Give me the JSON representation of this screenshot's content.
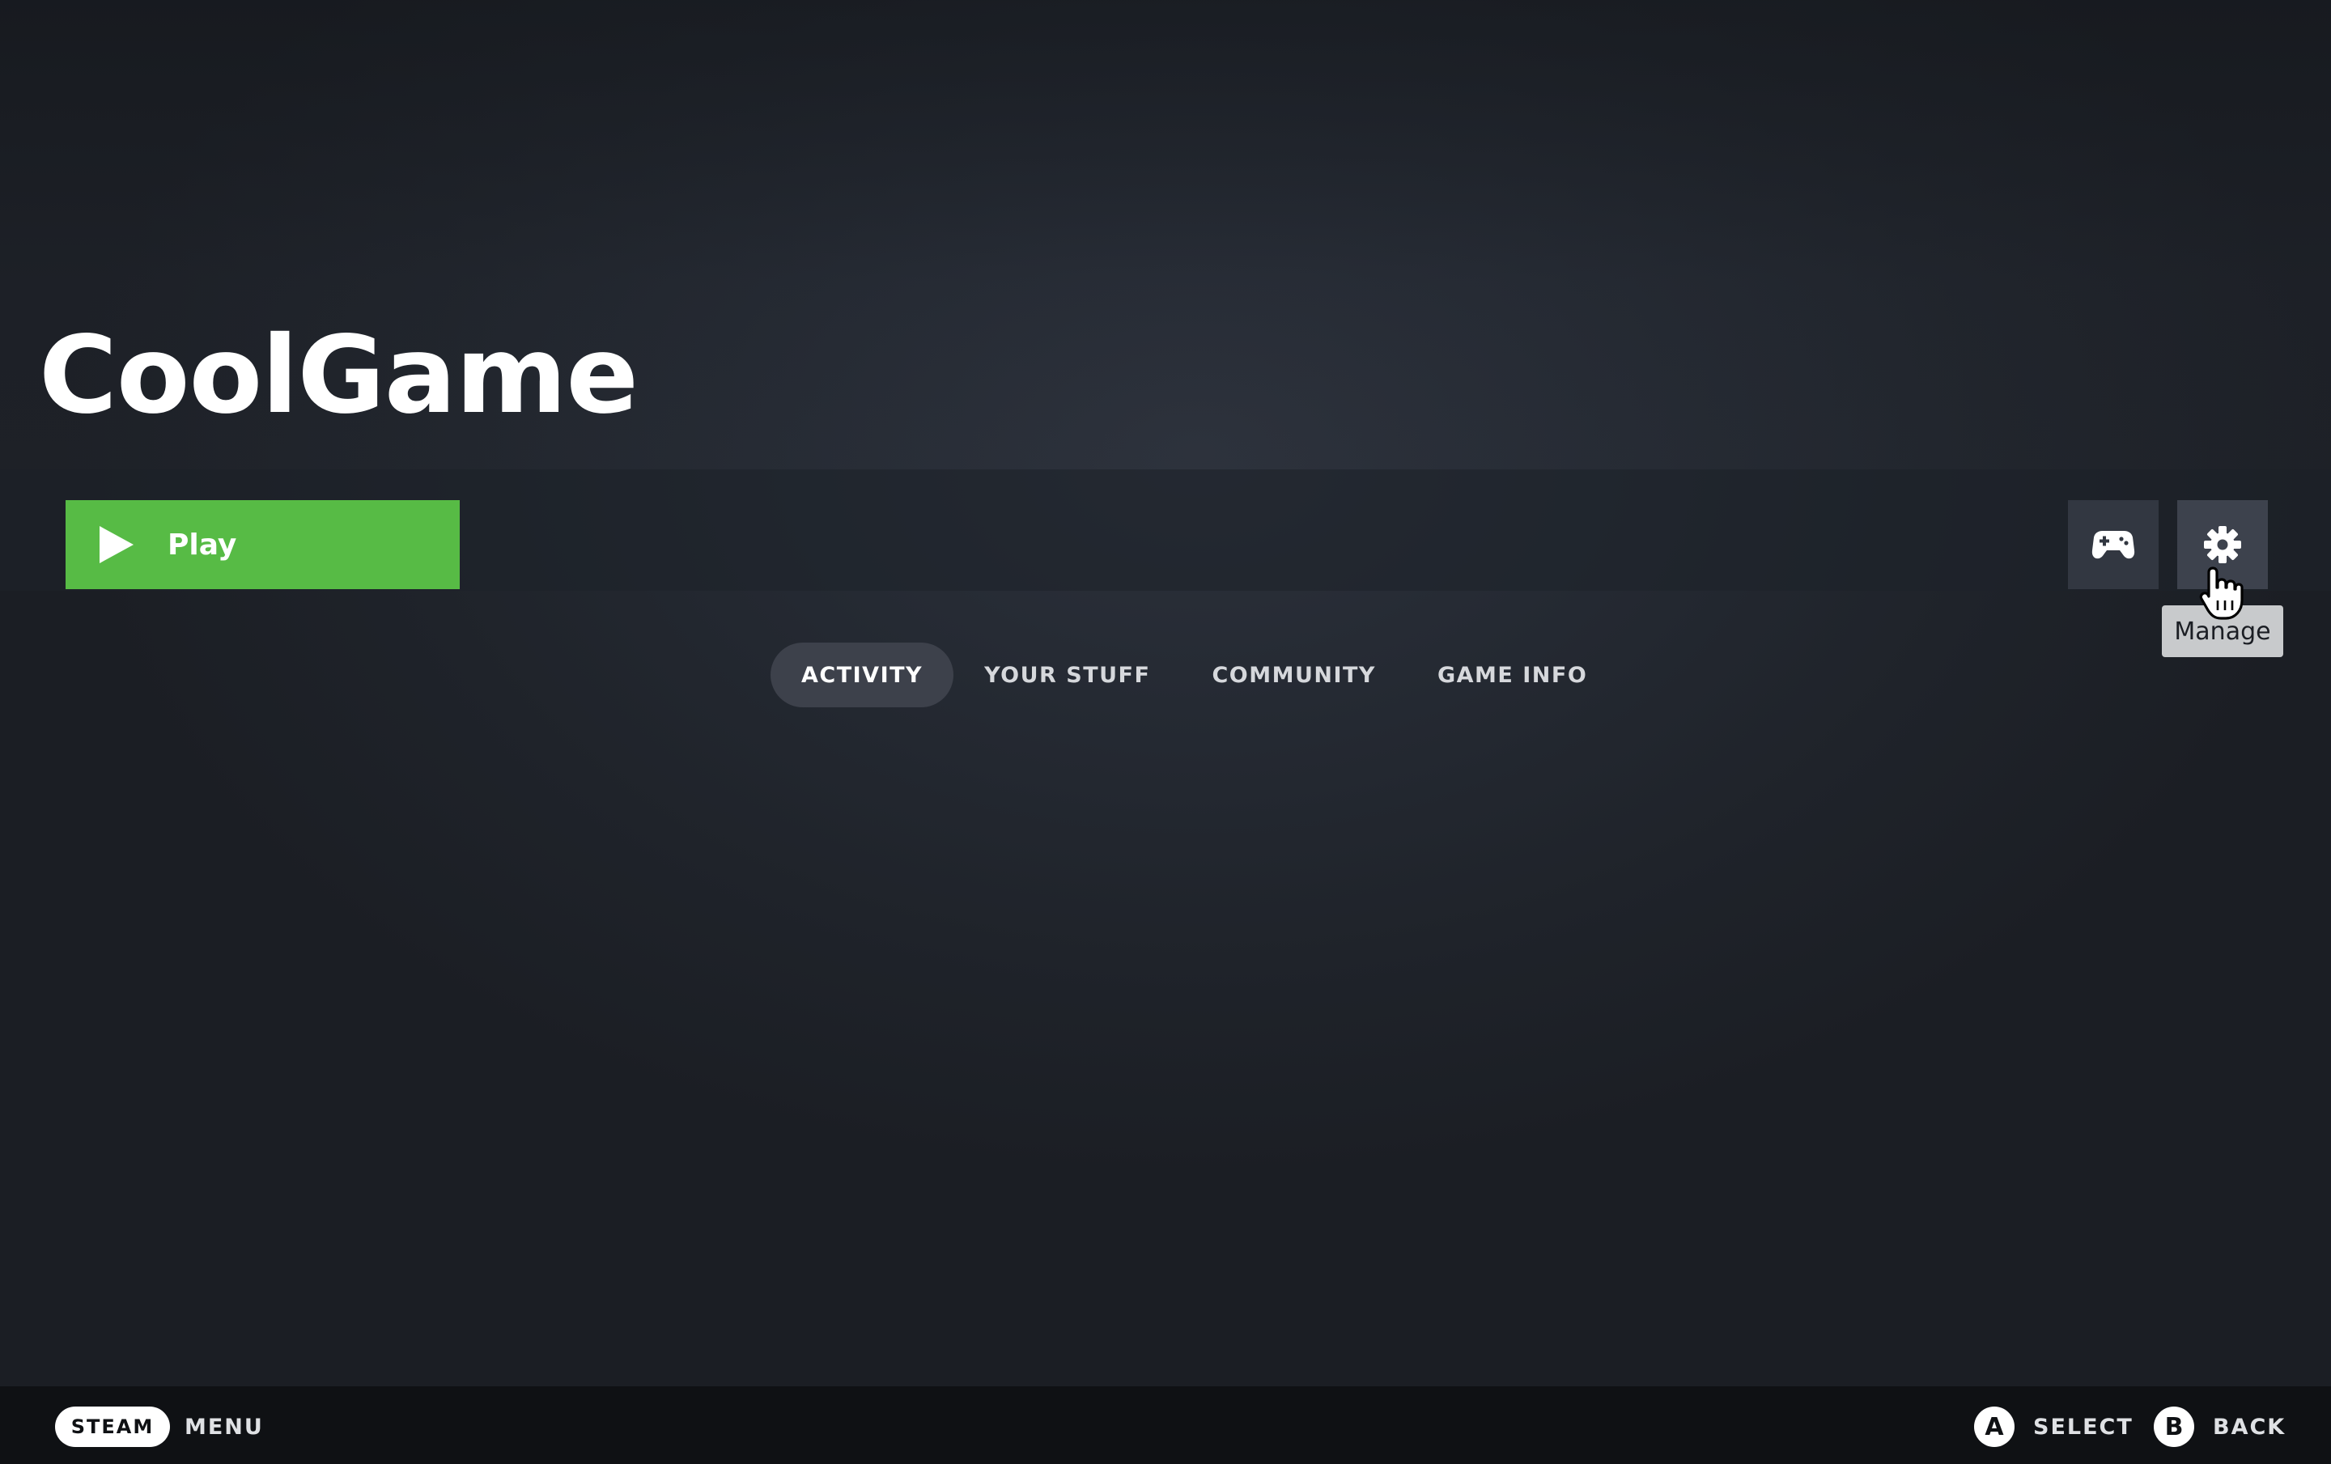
{
  "game": {
    "title": "CoolGame"
  },
  "actions": {
    "play_label": "Play",
    "controller_icon": "controller-icon",
    "manage_icon": "gear-icon",
    "manage_tooltip": "Manage"
  },
  "tabs": [
    {
      "label": "ACTIVITY",
      "active": true
    },
    {
      "label": "YOUR STUFF",
      "active": false
    },
    {
      "label": "COMMUNITY",
      "active": false
    },
    {
      "label": "GAME INFO",
      "active": false
    }
  ],
  "footer": {
    "steam_label": "STEAM",
    "menu_label": "MENU",
    "a_glyph": "A",
    "select_label": "SELECT",
    "b_glyph": "B",
    "back_label": "BACK"
  },
  "colors": {
    "play_green": "#57bb45",
    "background": "#1d2128",
    "footer": "#0f1114"
  }
}
